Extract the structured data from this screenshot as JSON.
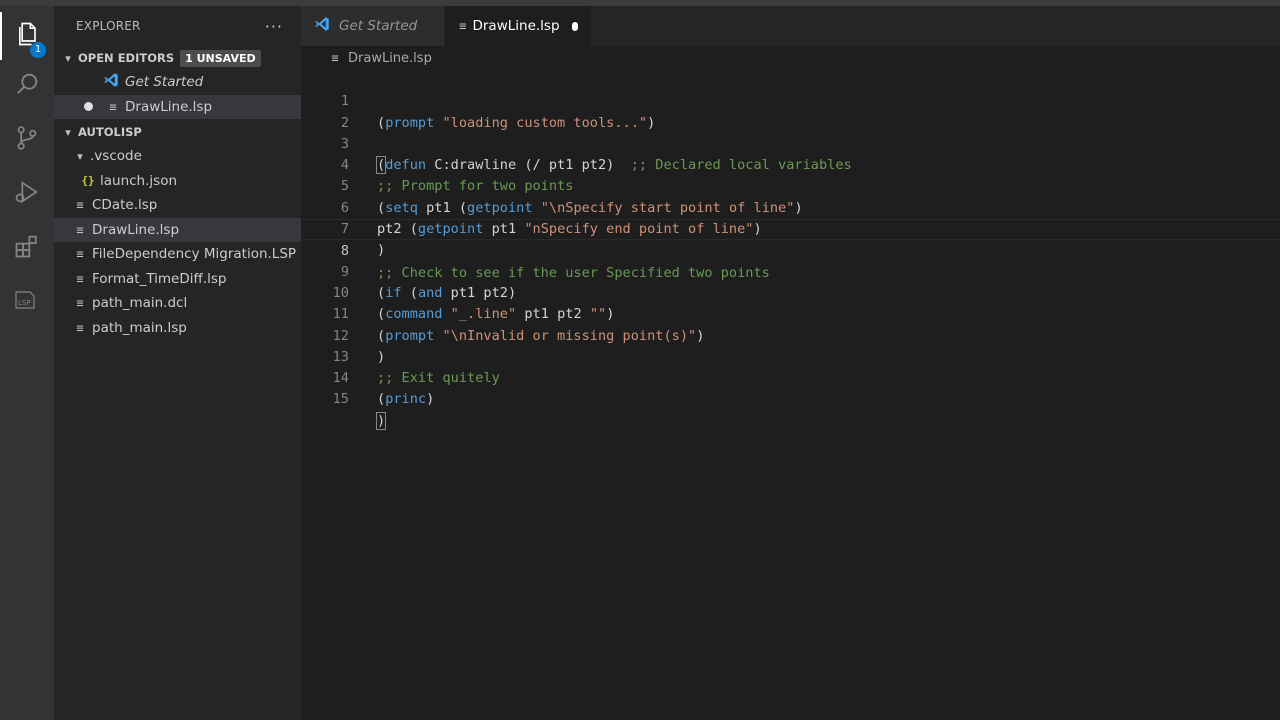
{
  "activity_bar": {
    "explorer_badge": "1",
    "items": [
      "files-icon",
      "search-icon",
      "source-control-icon",
      "run-debug-icon",
      "extensions-icon",
      "lsp-icon"
    ]
  },
  "sidebar": {
    "title": "EXPLORER",
    "more": "···",
    "open_editors": {
      "label": "OPEN EDITORS",
      "badge": "1 UNSAVED",
      "items": [
        {
          "label": "Get Started"
        },
        {
          "label": "DrawLine.lsp"
        }
      ]
    },
    "folder": {
      "label": "AUTOLISP",
      "vscode_folder": ".vscode",
      "launch_json": "launch.json",
      "files": [
        "CDate.lsp",
        "DrawLine.lsp",
        "FileDependency Migration.LSP",
        "Format_TimeDiff.lsp",
        "path_main.dcl",
        "path_main.lsp"
      ]
    }
  },
  "tabs": [
    {
      "label": "Get Started"
    },
    {
      "label": "DrawLine.lsp"
    }
  ],
  "breadcrumb": "DrawLine.lsp",
  "editor": {
    "current_line": 8,
    "line_numbers": [
      "1",
      "2",
      "3",
      "4",
      "5",
      "6",
      "7",
      "8",
      "9",
      "10",
      "11",
      "12",
      "13",
      "14",
      "15"
    ],
    "code": {
      "l1_a": "(",
      "l1_kw": "prompt",
      "l1_str": "\"loading custom tools...\"",
      "l1_b": ")",
      "l3_a": "(",
      "l3_kw": "defun",
      "l3_b": " C:drawline (/ pt1 pt2)  ",
      "l3_cmt": ";; Declared local variables",
      "l4_cmt": ";; Prompt for two points",
      "l5_a": "(",
      "l5_kw": "setq",
      "l5_b": " pt1 (",
      "l5_kw2": "getpoint",
      "l5_sp": " ",
      "l5_str": "\"\\nSpecify start point of line\"",
      "l5_c": ")",
      "l6_a": "pt2 (",
      "l6_kw": "getpoint",
      "l6_b": " pt1 ",
      "l6_str": "\"nSpecify end point of line\"",
      "l6_c": ")",
      "l7_a": ")",
      "l8_cmt": ";; Check to see if the user Specified two points",
      "l9_a": "(",
      "l9_kw": "if",
      "l9_b": " (",
      "l9_kw2": "and",
      "l9_c": " pt1 pt2)",
      "l10_a": "(",
      "l10_kw": "command",
      "l10_sp": " ",
      "l10_str": "\"_.line\"",
      "l10_b": " pt1 pt2 ",
      "l10_str2": "\"\"",
      "l10_c": ")",
      "l11_a": "(",
      "l11_kw": "prompt",
      "l11_sp": " ",
      "l11_str": "\"\\nInvalid or missing point(s)\"",
      "l11_b": ")",
      "l12_a": ")",
      "l13_cmt": ";; Exit quitely",
      "l14_a": "(",
      "l14_kw": "princ",
      "l14_b": ")",
      "l15_a": ")"
    }
  },
  "colors": {
    "keyword": "#569cd6",
    "string": "#ce9178",
    "comment": "#6a9955",
    "accent": "#007acc"
  }
}
